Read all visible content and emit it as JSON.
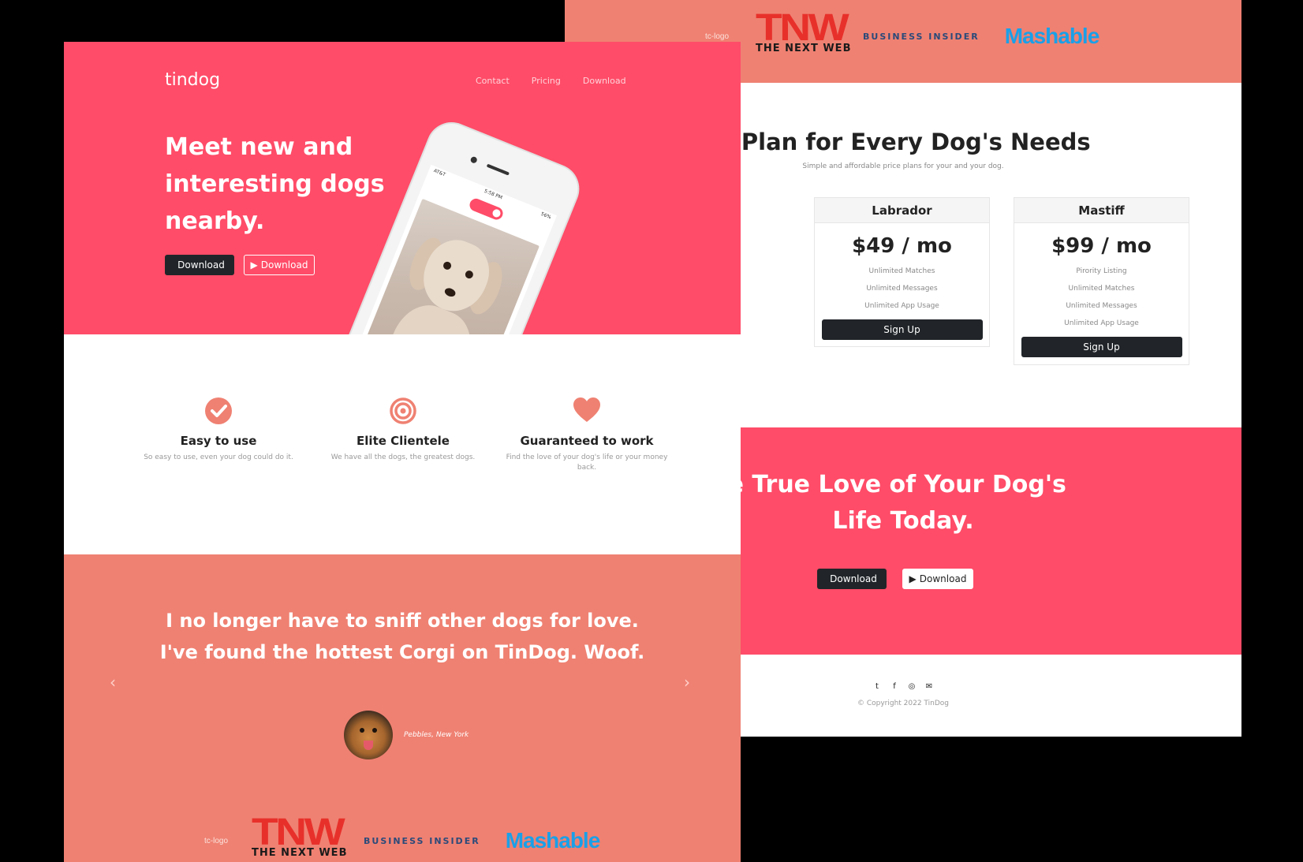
{
  "back_page": {
    "press": {
      "tc_alt": "tc-logo",
      "tnw_mark": "TNW",
      "tnw_text": "THE NEXT WEB",
      "business_insider": "BUSINESS INSIDER",
      "mashable": "Mashable"
    },
    "pricing": {
      "title": "A Plan for Every Dog's Needs",
      "subtitle": "Simple and affordable price plans for your and your dog.",
      "plans": [
        {
          "name": "Labrador",
          "price": "$49 / mo",
          "features": [
            "Unlimited Matches",
            "Unlimited Messages",
            "Unlimited App Usage"
          ],
          "button": "Sign Up"
        },
        {
          "name": "Mastiff",
          "price": "$99 / mo",
          "features": [
            "Pirority Listing",
            "Unlimited Matches",
            "Unlimited Messages",
            "Unlimited App Usage"
          ],
          "button": "Sign Up"
        }
      ]
    },
    "cta": {
      "line1": "l the True Love of Your Dog's",
      "line2": "Life Today.",
      "apple_button": "Download",
      "play_button": "Download"
    },
    "footer": {
      "icons": [
        "twitter-icon",
        "facebook-icon",
        "instagram-icon",
        "envelope-icon"
      ],
      "copyright": "© Copyright 2022 TinDog"
    }
  },
  "front_page": {
    "brand": "tindog",
    "nav": [
      "Contact",
      "Pricing",
      "Download"
    ],
    "hero": {
      "title": "Meet new and interesting dogs nearby.",
      "apple_button": "Download",
      "play_button": "Download"
    },
    "phone": {
      "carrier": "AT&T",
      "time": "5:58 PM",
      "battery": "56%"
    },
    "features": [
      {
        "icon": "check-circle-icon",
        "title": "Easy to use",
        "text": "So easy to use, even your dog could do it."
      },
      {
        "icon": "bullseye-icon",
        "title": "Elite Clientele",
        "text": "We have all the dogs, the greatest dogs."
      },
      {
        "icon": "heart-icon",
        "title": "Guaranteed to work",
        "text": "Find the love of your dog's life or your money back."
      }
    ],
    "testimonial": {
      "quote": "I no longer have to sniff other dogs for love. I've found the hottest Corgi on TinDog. Woof.",
      "author": "Pebbles, New York"
    },
    "press": {
      "tc_alt": "tc-logo",
      "tnw_mark": "TNW",
      "tnw_text": "THE NEXT WEB",
      "business_insider": "BUSINESS INSIDER",
      "mashable": "Mashable"
    }
  },
  "colors": {
    "primary": "#ff4c68",
    "salmon": "#ef8172",
    "dark": "#212529"
  }
}
